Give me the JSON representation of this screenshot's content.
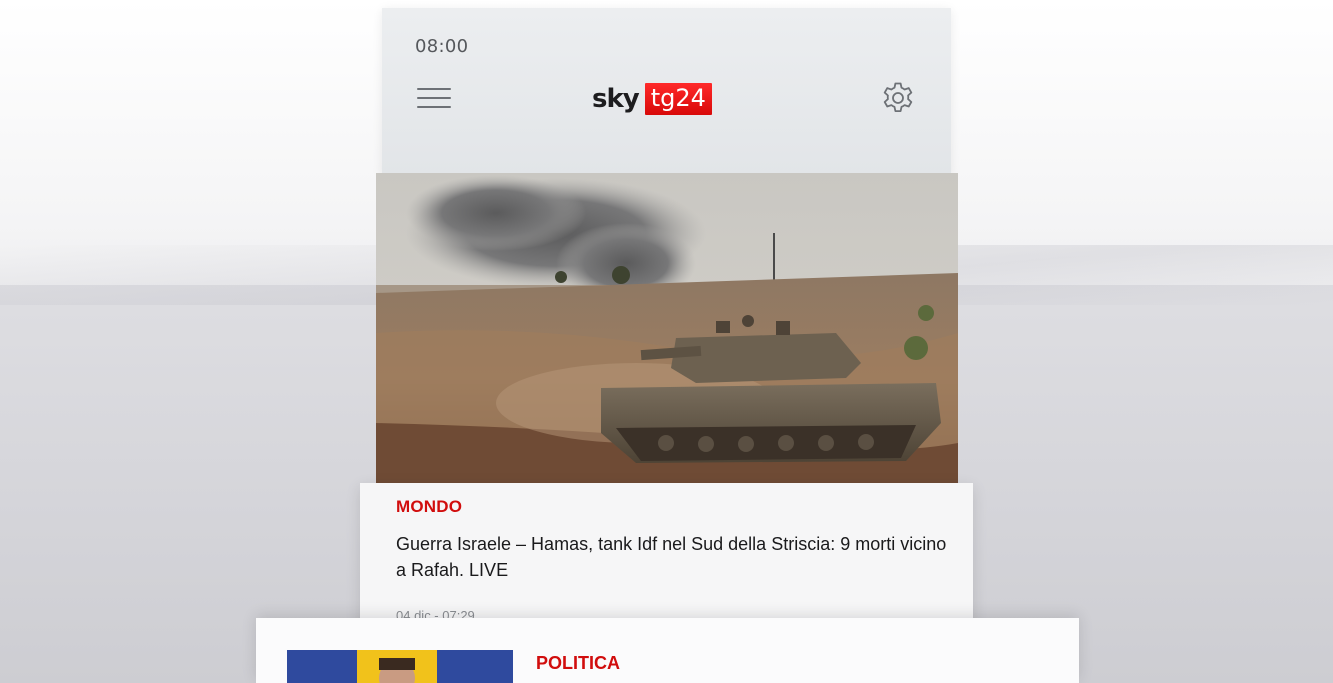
{
  "status_bar": {
    "time": "08:00"
  },
  "header": {
    "menu_icon": "hamburger-icon",
    "logo": {
      "sky": "sky",
      "tg": "tg24"
    },
    "settings_icon": "gear-icon"
  },
  "colors": {
    "brand_red": "#e01010",
    "category_red": "#d10d0d",
    "header_bg": "#e6e8eb"
  },
  "articles": [
    {
      "category": "MONDO",
      "headline": "Guerra Israele – Hamas,  tank Idf nel Sud della Striscia: 9 morti vicino a Rafah. LIVE",
      "timestamp": "04 dic - 07:29",
      "image": "tank-in-desert-photo"
    },
    {
      "category": "POLITICA",
      "image": "politician-photo"
    }
  ]
}
